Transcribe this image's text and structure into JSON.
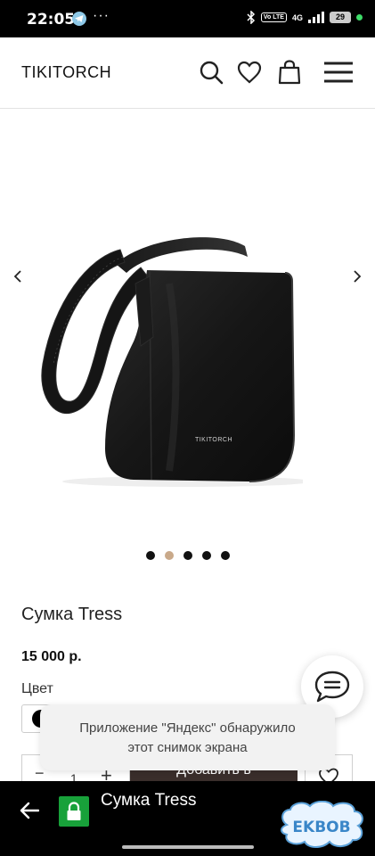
{
  "status_bar": {
    "time": "22:05",
    "more": "···",
    "volte": "Vo LTE",
    "network": "4G",
    "battery": "29",
    "icons": [
      "telegram-icon",
      "bluetooth-icon",
      "signal-icon",
      "battery-icon"
    ]
  },
  "header": {
    "logo": "TIKITORCH",
    "icons": [
      "search-icon",
      "heart-icon",
      "bag-icon",
      "menu-icon"
    ]
  },
  "gallery": {
    "slide_count": 5,
    "active_slide": 2,
    "bag_logo": "TIKITORCH"
  },
  "product": {
    "title": "Сумка Tress",
    "price": "15 000 р.",
    "color_label": "Цвет",
    "quantity": "1",
    "minus": "−",
    "plus": "+",
    "add_button": "Добавить в"
  },
  "toast": {
    "line1": "Приложение \"Яндекс\" обнаружило",
    "line2": "этот снимок экрана"
  },
  "browser_bar": {
    "title": "Сумка Tress"
  },
  "watermark": {
    "text": "EKBOB"
  },
  "colors": {
    "accent_dot": "#c9a98a",
    "add_button_bg": "#3a2e2b",
    "lock_green": "#18a13a"
  }
}
